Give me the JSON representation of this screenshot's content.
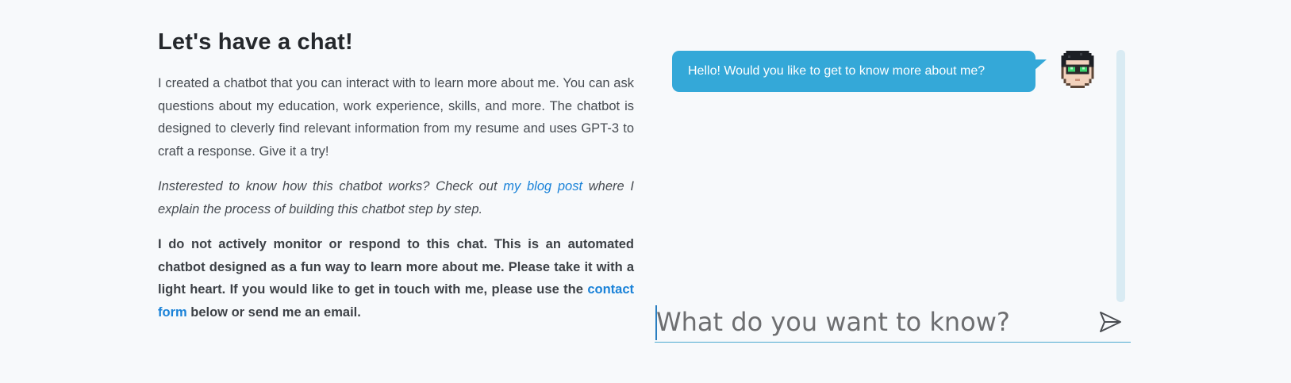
{
  "intro": {
    "heading": "Let's have a chat!",
    "paragraph1": "I created a chatbot that you can interact with to learn more about me. You can ask questions about my education, work experience, skills, and more. The chatbot is designed to cleverly find relevant information from my resume and uses GPT-3 to craft a response. Give it a try!",
    "paragraph2_before": "Insterested to know how this chatbot works? Check out ",
    "paragraph2_link": "my blog post",
    "paragraph2_after": " where I explain the process of building this chatbot step by step.",
    "paragraph3_before": "I do not actively monitor or respond to this chat. This is an automated chatbot designed as a fun way to learn more about me. Please take it with a light heart. If you would like to get in touch with me, please use the ",
    "paragraph3_link": "contact form",
    "paragraph3_after": " below or send me an email."
  },
  "chat": {
    "messages": [
      {
        "sender": "bot",
        "text": "Hello! Would you like to get to know more about me?"
      }
    ],
    "input_placeholder": "What do you want to know?",
    "input_value": "",
    "send_icon": "send-icon",
    "avatar_icon": "pixel-avatar-icon"
  },
  "colors": {
    "background": "#f7f9fb",
    "bubble": "#34a8d8",
    "link": "#1a82d8",
    "scrollbar": "#d9ebf3",
    "input_underline": "#4aa9cf"
  }
}
